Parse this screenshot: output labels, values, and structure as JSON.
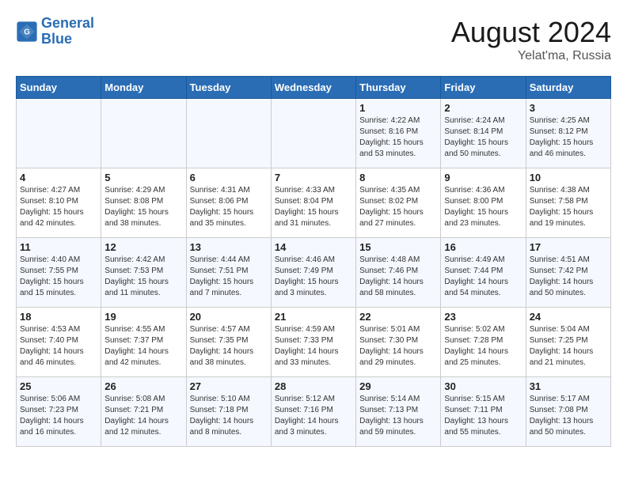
{
  "header": {
    "logo_line1": "General",
    "logo_line2": "Blue",
    "main_title": "August 2024",
    "subtitle": "Yelat'ma, Russia"
  },
  "days_of_week": [
    "Sunday",
    "Monday",
    "Tuesday",
    "Wednesday",
    "Thursday",
    "Friday",
    "Saturday"
  ],
  "weeks": [
    [
      {
        "day": "",
        "info": ""
      },
      {
        "day": "",
        "info": ""
      },
      {
        "day": "",
        "info": ""
      },
      {
        "day": "",
        "info": ""
      },
      {
        "day": "1",
        "info": "Sunrise: 4:22 AM\nSunset: 8:16 PM\nDaylight: 15 hours\nand 53 minutes."
      },
      {
        "day": "2",
        "info": "Sunrise: 4:24 AM\nSunset: 8:14 PM\nDaylight: 15 hours\nand 50 minutes."
      },
      {
        "day": "3",
        "info": "Sunrise: 4:25 AM\nSunset: 8:12 PM\nDaylight: 15 hours\nand 46 minutes."
      }
    ],
    [
      {
        "day": "4",
        "info": "Sunrise: 4:27 AM\nSunset: 8:10 PM\nDaylight: 15 hours\nand 42 minutes."
      },
      {
        "day": "5",
        "info": "Sunrise: 4:29 AM\nSunset: 8:08 PM\nDaylight: 15 hours\nand 38 minutes."
      },
      {
        "day": "6",
        "info": "Sunrise: 4:31 AM\nSunset: 8:06 PM\nDaylight: 15 hours\nand 35 minutes."
      },
      {
        "day": "7",
        "info": "Sunrise: 4:33 AM\nSunset: 8:04 PM\nDaylight: 15 hours\nand 31 minutes."
      },
      {
        "day": "8",
        "info": "Sunrise: 4:35 AM\nSunset: 8:02 PM\nDaylight: 15 hours\nand 27 minutes."
      },
      {
        "day": "9",
        "info": "Sunrise: 4:36 AM\nSunset: 8:00 PM\nDaylight: 15 hours\nand 23 minutes."
      },
      {
        "day": "10",
        "info": "Sunrise: 4:38 AM\nSunset: 7:58 PM\nDaylight: 15 hours\nand 19 minutes."
      }
    ],
    [
      {
        "day": "11",
        "info": "Sunrise: 4:40 AM\nSunset: 7:55 PM\nDaylight: 15 hours\nand 15 minutes."
      },
      {
        "day": "12",
        "info": "Sunrise: 4:42 AM\nSunset: 7:53 PM\nDaylight: 15 hours\nand 11 minutes."
      },
      {
        "day": "13",
        "info": "Sunrise: 4:44 AM\nSunset: 7:51 PM\nDaylight: 15 hours\nand 7 minutes."
      },
      {
        "day": "14",
        "info": "Sunrise: 4:46 AM\nSunset: 7:49 PM\nDaylight: 15 hours\nand 3 minutes."
      },
      {
        "day": "15",
        "info": "Sunrise: 4:48 AM\nSunset: 7:46 PM\nDaylight: 14 hours\nand 58 minutes."
      },
      {
        "day": "16",
        "info": "Sunrise: 4:49 AM\nSunset: 7:44 PM\nDaylight: 14 hours\nand 54 minutes."
      },
      {
        "day": "17",
        "info": "Sunrise: 4:51 AM\nSunset: 7:42 PM\nDaylight: 14 hours\nand 50 minutes."
      }
    ],
    [
      {
        "day": "18",
        "info": "Sunrise: 4:53 AM\nSunset: 7:40 PM\nDaylight: 14 hours\nand 46 minutes."
      },
      {
        "day": "19",
        "info": "Sunrise: 4:55 AM\nSunset: 7:37 PM\nDaylight: 14 hours\nand 42 minutes."
      },
      {
        "day": "20",
        "info": "Sunrise: 4:57 AM\nSunset: 7:35 PM\nDaylight: 14 hours\nand 38 minutes."
      },
      {
        "day": "21",
        "info": "Sunrise: 4:59 AM\nSunset: 7:33 PM\nDaylight: 14 hours\nand 33 minutes."
      },
      {
        "day": "22",
        "info": "Sunrise: 5:01 AM\nSunset: 7:30 PM\nDaylight: 14 hours\nand 29 minutes."
      },
      {
        "day": "23",
        "info": "Sunrise: 5:02 AM\nSunset: 7:28 PM\nDaylight: 14 hours\nand 25 minutes."
      },
      {
        "day": "24",
        "info": "Sunrise: 5:04 AM\nSunset: 7:25 PM\nDaylight: 14 hours\nand 21 minutes."
      }
    ],
    [
      {
        "day": "25",
        "info": "Sunrise: 5:06 AM\nSunset: 7:23 PM\nDaylight: 14 hours\nand 16 minutes."
      },
      {
        "day": "26",
        "info": "Sunrise: 5:08 AM\nSunset: 7:21 PM\nDaylight: 14 hours\nand 12 minutes."
      },
      {
        "day": "27",
        "info": "Sunrise: 5:10 AM\nSunset: 7:18 PM\nDaylight: 14 hours\nand 8 minutes."
      },
      {
        "day": "28",
        "info": "Sunrise: 5:12 AM\nSunset: 7:16 PM\nDaylight: 14 hours\nand 3 minutes."
      },
      {
        "day": "29",
        "info": "Sunrise: 5:14 AM\nSunset: 7:13 PM\nDaylight: 13 hours\nand 59 minutes."
      },
      {
        "day": "30",
        "info": "Sunrise: 5:15 AM\nSunset: 7:11 PM\nDaylight: 13 hours\nand 55 minutes."
      },
      {
        "day": "31",
        "info": "Sunrise: 5:17 AM\nSunset: 7:08 PM\nDaylight: 13 hours\nand 50 minutes."
      }
    ]
  ]
}
